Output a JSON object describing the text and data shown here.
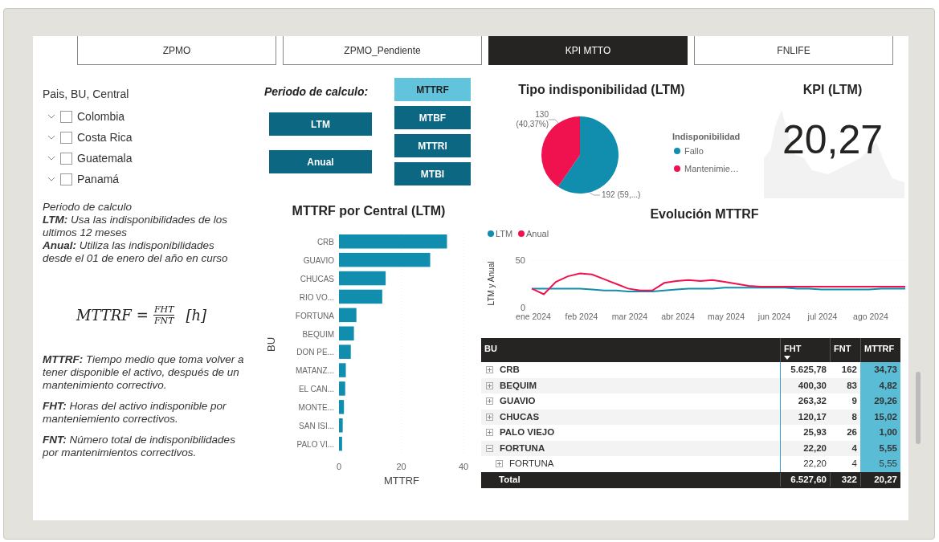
{
  "tabs": [
    {
      "label": "ZPMO",
      "selected": false
    },
    {
      "label": "ZPMO_Pendiente",
      "selected": false
    },
    {
      "label": "KPI MTTO",
      "selected": true
    },
    {
      "label": "FNLIFE",
      "selected": false
    }
  ],
  "slicer": {
    "title": "Pais, BU, Central",
    "items": [
      {
        "label": "Colombia",
        "checked": false,
        "expanded": false
      },
      {
        "label": "Costa Rica",
        "checked": false,
        "expanded": false
      },
      {
        "label": "Guatemala",
        "checked": false,
        "expanded": false
      },
      {
        "label": "Panamá",
        "checked": false,
        "expanded": false
      }
    ]
  },
  "notes": [
    "*Periodo de calculo*",
    "**LTM:** Usa las indisponibilidades de los ultimos 12 meses",
    "**Anual:** Utiliza las indisponibilidades desde el 01 de enero del año en curso"
  ],
  "formula": {
    "lhs": "MTTRF",
    "equals": "=",
    "numerator": "FHT",
    "denominator": "FNT",
    "unit": "[h]"
  },
  "definitions": [
    "**MTTRF:** Tiempo medio que toma volver a tener disponible el activo, después de un mantenimiento correctivo.",
    "**FHT:** Horas del activo indisponible por manteniemiento correctivos.",
    "**FNT:** Número total de indisponibilidades por mantenimientos correctivos."
  ],
  "period": {
    "title": "Periodo de calculo:",
    "buttons": [
      {
        "label": "LTM",
        "selected": false
      },
      {
        "label": "Anual",
        "selected": false
      }
    ]
  },
  "metric_buttons": [
    {
      "label": "MTTRF",
      "selected": true
    },
    {
      "label": "MTBF",
      "selected": false
    },
    {
      "label": "MTTRI",
      "selected": false
    },
    {
      "label": "MTBI",
      "selected": false
    }
  ],
  "pie": {
    "chart_data": {
      "type": "pie",
      "title": "Tipo indisponibilidad (LTM)",
      "categories": [
        "Fallo",
        "Mantenimie…"
      ],
      "values": [
        192,
        130
      ],
      "colors": [
        "#118dae",
        "#f0124f"
      ],
      "value_labels": [
        "192 (59,...)",
        "130 (40,37%)"
      ],
      "legend": "right"
    },
    "legend_title": "Indisponibilidad"
  },
  "kpi": {
    "title": "KPI (LTM)",
    "value": "20,27"
  },
  "bar_chart": {
    "chart_data": {
      "type": "bar",
      "orientation": "horizontal",
      "title": "MTTRF por Central (LTM)",
      "xlabel": "MTTRF",
      "ylabel": "BU",
      "categories": [
        "CRB",
        "GUAVIO",
        "CHUCAS",
        "RIO VO...",
        "FORTUNA",
        "BEQUIM",
        "DON PE...",
        "MATANZ...",
        "EL CAN...",
        "MONTE...",
        "SAN ISI...",
        "PALO VI..."
      ],
      "series": [
        {
          "color": "#118dae",
          "values": [
            34.7,
            29.3,
            15,
            13.9,
            5.6,
            4.8,
            3.8,
            2.2,
            2,
            1.6,
            1.2,
            1
          ]
        }
      ],
      "xlim": [
        0,
        40
      ],
      "xticks": [
        0,
        20,
        40
      ]
    }
  },
  "line_chart": {
    "chart_data": {
      "type": "line",
      "title": "Evolución MTTRF",
      "ylabel": "LTM y Anual",
      "categories": [
        "ene 2024",
        null,
        null,
        null,
        "feb 2024",
        null,
        null,
        null,
        "mar 2024",
        null,
        null,
        null,
        "abr 2024",
        null,
        null,
        null,
        "may 2024",
        null,
        null,
        null,
        "jun 2024",
        null,
        null,
        null,
        "jul 2024",
        null,
        null,
        null,
        "ago 2024",
        null,
        null,
        null
      ],
      "series": [
        {
          "name": "LTM",
          "color": "#118dae",
          "values": [
            20,
            20,
            20,
            20,
            20,
            19,
            18,
            18,
            17,
            17,
            17,
            18,
            19,
            20,
            20,
            20,
            21,
            21,
            21,
            21,
            21,
            21,
            20,
            20,
            19,
            19,
            19,
            19,
            19,
            20,
            20,
            20
          ]
        },
        {
          "name": "Anual",
          "color": "#f0124f",
          "values": [
            20,
            14,
            27,
            33,
            36,
            35,
            30,
            25,
            20,
            18,
            18,
            26,
            28,
            29,
            28,
            29,
            27,
            25,
            23,
            22,
            22,
            22,
            22,
            22,
            22,
            22,
            22,
            22,
            22,
            22,
            22,
            22
          ]
        }
      ],
      "ylim": [
        0,
        50
      ],
      "yticks": [
        0,
        50
      ],
      "legend": "top-left"
    }
  },
  "table": {
    "columns": [
      {
        "label": "BU",
        "sorted": false
      },
      {
        "label": "FHT",
        "sorted": true
      },
      {
        "label": "FNT",
        "sorted": false
      },
      {
        "label": "MTTRF",
        "sorted": false
      }
    ],
    "rows": [
      {
        "cells": [
          "CRB",
          "5.625,78",
          "162",
          "34,73"
        ],
        "expanded": false
      },
      {
        "cells": [
          "BEQUIM",
          "400,30",
          "83",
          "4,82"
        ],
        "expanded": false
      },
      {
        "cells": [
          "GUAVIO",
          "263,32",
          "9",
          "29,26"
        ],
        "expanded": false
      },
      {
        "cells": [
          "CHUCAS",
          "120,17",
          "8",
          "15,02"
        ],
        "expanded": false
      },
      {
        "cells": [
          "PALO VIEJO",
          "25,93",
          "26",
          "1,00"
        ],
        "expanded": false
      },
      {
        "cells": [
          "FORTUNA",
          "22,20",
          "4",
          "5,55"
        ],
        "expanded": true,
        "children": [
          {
            "cells": [
              "FORTUNA",
              "22,20",
              "4",
              "5,55"
            ],
            "expanded": false
          }
        ]
      }
    ],
    "total": [
      "Total",
      "6.527,60",
      "322",
      "20,27"
    ]
  }
}
